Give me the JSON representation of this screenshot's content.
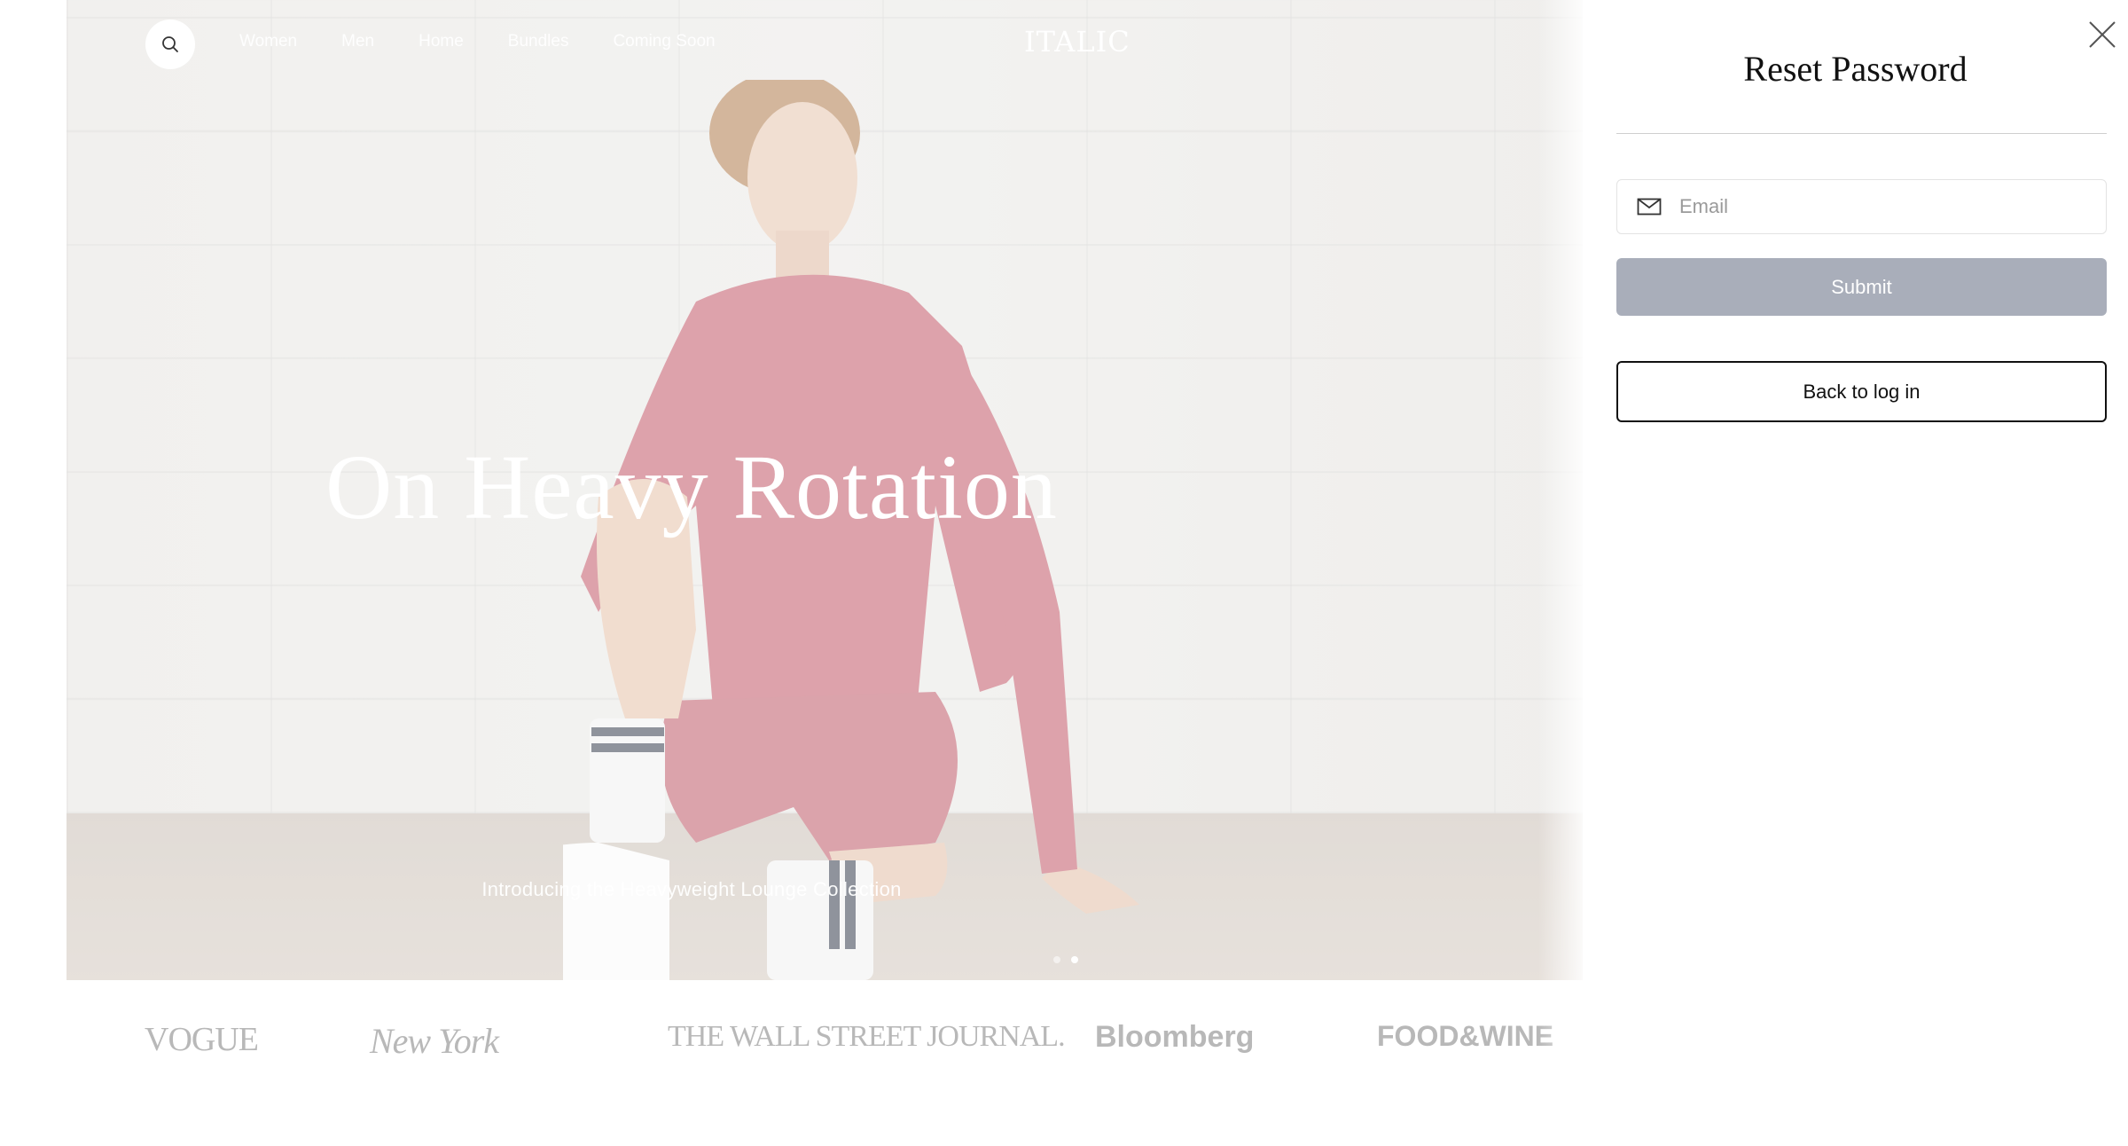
{
  "nav": {
    "links": [
      "Women",
      "Men",
      "Home",
      "Bundles",
      "Coming Soon"
    ],
    "logo": "ITALIC"
  },
  "hero": {
    "title": "On Heavy Rotation",
    "subtitle": "Introducing the Heavyweight Lounge Collection",
    "carousel": {
      "slides": 2,
      "active_index": 2
    }
  },
  "press": {
    "logos": [
      "VOGUE",
      "New York",
      "THE WALL STREET JOURNAL.",
      "Bloomberg",
      "FOOD&WINE"
    ]
  },
  "drawer": {
    "title": "Reset Password",
    "email_placeholder": "Email",
    "email_value": "",
    "submit_label": "Submit",
    "back_label": "Back to log in",
    "submit_color": "#a9aeba"
  }
}
